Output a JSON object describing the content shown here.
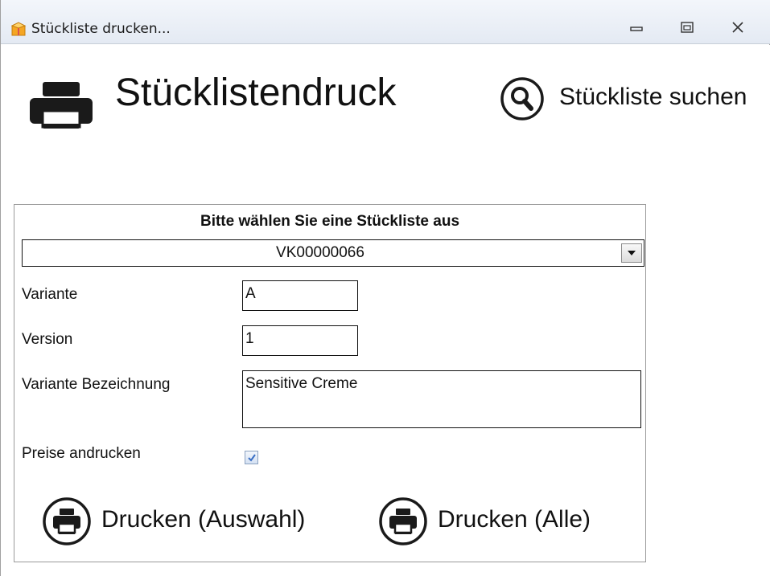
{
  "window": {
    "title": "Stückliste drucken...",
    "icon": "app-box-icon"
  },
  "header": {
    "title": "Stücklistendruck",
    "print_icon": "printer-icon",
    "search_label": "Stückliste suchen",
    "search_icon": "magnifier-icon"
  },
  "form": {
    "heading": "Bitte wählen Sie eine Stückliste aus",
    "selected_bom": "VK00000066",
    "variante_label": "Variante",
    "variante_value": "A",
    "version_label": "Version",
    "version_value": "1",
    "bezeichnung_label": "Variante Bezeichnung",
    "bezeichnung_value": "Sensitive Creme",
    "preise_label": "Preise andrucken",
    "preise_checked": true
  },
  "actions": {
    "print_selection_label": "Drucken (Auswahl)",
    "print_all_label": "Drucken (Alle)"
  },
  "colors": {
    "accent_check": "#3a6fc4",
    "icon_dark": "#1a1a1a"
  }
}
